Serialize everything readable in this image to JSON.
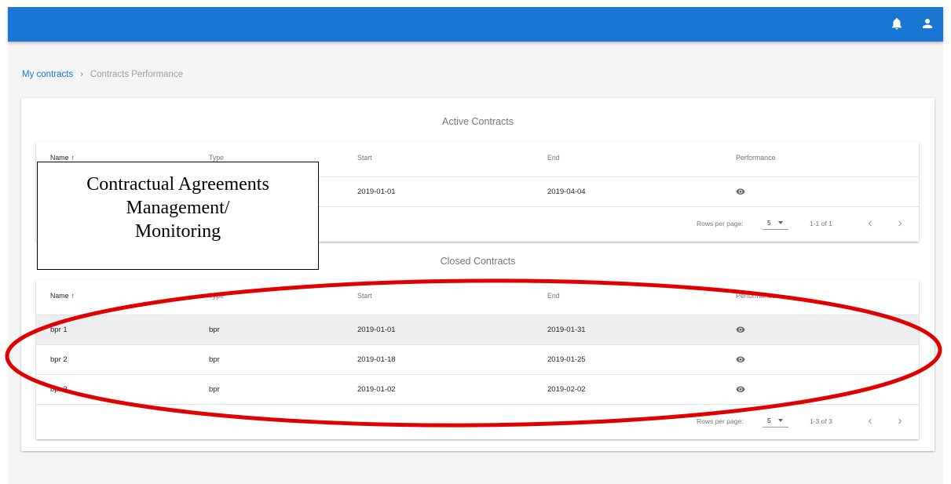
{
  "breadcrumb": {
    "home": "My contracts",
    "separator": "›",
    "current": "Contracts Performance"
  },
  "columns": {
    "name": "Name",
    "type": "Type",
    "start": "Start",
    "end": "End",
    "performance": "Performance"
  },
  "active": {
    "title": "Active Contracts",
    "rows": [
      {
        "name": "",
        "type": "",
        "start": "2019-01-01",
        "end": "2019-04-04"
      }
    ],
    "footer": {
      "rows_per_page_label": "Rows per page:",
      "rows_per_page": "5",
      "range": "1-1 of 1"
    }
  },
  "closed": {
    "title": "Closed Contracts",
    "rows": [
      {
        "name": "bpr 1",
        "type": "bpr",
        "start": "2019-01-01",
        "end": "2019-01-31"
      },
      {
        "name": "bpr 2",
        "type": "bpr",
        "start": "2019-01-18",
        "end": "2019-01-25"
      },
      {
        "name": "bpr 3",
        "type": "bpr",
        "start": "2019-01-02",
        "end": "2019-02-02"
      }
    ],
    "footer": {
      "rows_per_page_label": "Rows per page:",
      "rows_per_page": "5",
      "range": "1-3 of 3"
    }
  },
  "annotation": {
    "lines": [
      "Contractual Agreements",
      "Management/",
      "Monitoring"
    ]
  },
  "colors": {
    "appbar": "#1976d2",
    "highlight_ellipse": "#e00000",
    "background": "#f5f5f5"
  },
  "icons": {
    "appbar": [
      "bell-icon",
      "user-icon"
    ],
    "row": "eye-icon",
    "sort": "arrow-up-icon"
  }
}
